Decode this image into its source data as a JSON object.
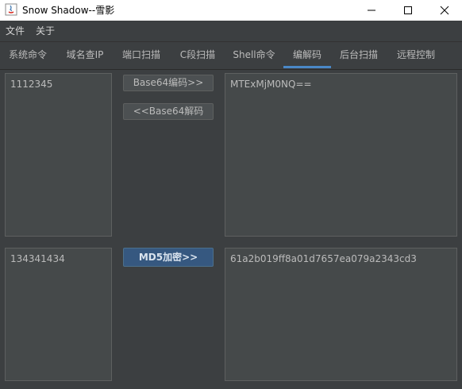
{
  "window": {
    "title": "Snow Shadow--雪影",
    "icon": "java-icon"
  },
  "menu": {
    "items": [
      {
        "label": "文件"
      },
      {
        "label": "关于"
      }
    ]
  },
  "tabs": [
    {
      "label": "系统命令"
    },
    {
      "label": "域名查IP"
    },
    {
      "label": "端口扫描"
    },
    {
      "label": "C段扫描"
    },
    {
      "label": "Shell命令"
    },
    {
      "label": "编解码",
      "active": true
    },
    {
      "label": "后台扫描"
    },
    {
      "label": "远程控制"
    }
  ],
  "base64": {
    "input": "1112345",
    "output": "MTExMjM0NQ==",
    "encode_label": "Base64编码>>",
    "decode_label": "<<Base64解码"
  },
  "md5": {
    "input": "134341434",
    "output": "61a2b019ff8a01d7657ea079a2343cd3",
    "encrypt_label": "MD5加密>>"
  },
  "colors": {
    "background": "#3c3f41",
    "accent": "#4a88c7",
    "primary_button": "#365880"
  }
}
